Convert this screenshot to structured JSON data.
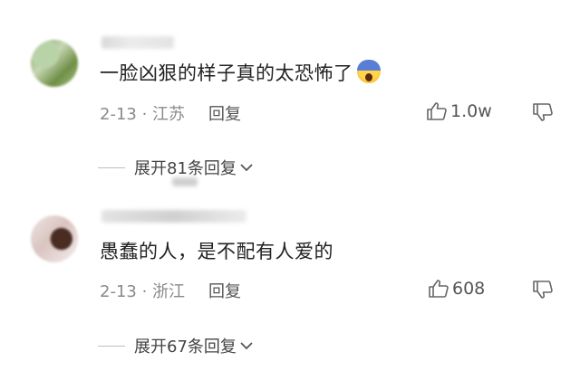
{
  "comments": [
    {
      "text": "一脸凶狠的样子真的太恐怖了",
      "emoji": "scream-emoji",
      "date_location": "2-13 · 江苏",
      "reply_label": "回复",
      "likes": "1.0w",
      "expand_label": "展开81条回复"
    },
    {
      "text": "愚蠢的人，是不配有人爱的",
      "date_location": "2-13 · 浙江",
      "reply_label": "回复",
      "likes": "608",
      "expand_label": "展开67条回复"
    }
  ]
}
